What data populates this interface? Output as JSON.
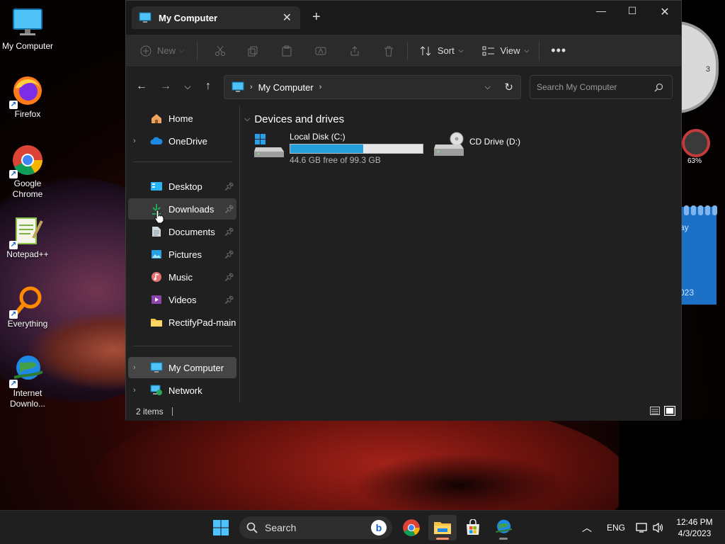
{
  "desktop": {
    "icons": [
      {
        "label": "My Computer",
        "icon": "monitor-icon"
      },
      {
        "label": "Firefox",
        "icon": "firefox-icon"
      },
      {
        "label": "Google Chrome",
        "icon": "chrome-icon"
      },
      {
        "label": "Notepad++",
        "icon": "notepadpp-icon"
      },
      {
        "label": "Everything",
        "icon": "magnifier-icon"
      },
      {
        "label": "Internet Downlo...",
        "icon": "idm-globe-icon"
      }
    ],
    "widgets": {
      "clock_number": "3",
      "gauge_percent": "63%",
      "calendar_text_top": "ay",
      "calendar_text_bottom": "023"
    }
  },
  "window": {
    "tab_title": "My Computer",
    "toolbar": {
      "new_label": "New",
      "sort_label": "Sort",
      "view_label": "View"
    },
    "address": {
      "path": "My Computer",
      "search_placeholder": "Search My Computer"
    },
    "nav": {
      "home": "Home",
      "onedrive": "OneDrive",
      "quick_access": [
        {
          "label": "Desktop",
          "icon": "desktop-folder-icon"
        },
        {
          "label": "Downloads",
          "icon": "download-arrow-icon"
        },
        {
          "label": "Documents",
          "icon": "documents-icon"
        },
        {
          "label": "Pictures",
          "icon": "pictures-icon"
        },
        {
          "label": "Music",
          "icon": "music-icon"
        },
        {
          "label": "Videos",
          "icon": "videos-icon"
        }
      ],
      "folder": "RectifyPad-main",
      "my_computer": "My Computer",
      "network": "Network",
      "hovered": "Downloads",
      "selected": "My Computer"
    },
    "content": {
      "group_heading": "Devices and drives",
      "drives": [
        {
          "name": "Local Disk (C:)",
          "free_text": "44.6 GB free of 99.3 GB",
          "used_fraction": 0.551
        },
        {
          "name": "CD Drive (D:)"
        }
      ]
    },
    "status": {
      "items": "2 items"
    }
  },
  "taskbar": {
    "search_label": "Search",
    "language": "ENG",
    "time": "12:46 PM",
    "date": "4/3/2023",
    "accent": "#ff8d6a"
  },
  "colors": {
    "window_bg": "#202020",
    "progress_fill": "#26a0da",
    "selected_bg": "#454545"
  }
}
